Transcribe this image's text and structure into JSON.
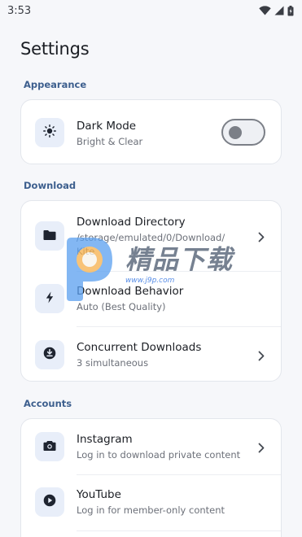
{
  "status_bar": {
    "time": "3:53",
    "icons": [
      "wifi-icon",
      "signal-icon",
      "battery-icon"
    ]
  },
  "page_title": "Settings",
  "sections": {
    "appearance": {
      "label": "Appearance",
      "dark_mode": {
        "title": "Dark Mode",
        "subtitle": "Bright & Clear",
        "icon": "sun-icon",
        "enabled": false
      }
    },
    "download": {
      "label": "Download",
      "directory": {
        "title": "Download Directory",
        "subtitle": "/storage/emulated/0/Download/",
        "subtitle2": "Kite",
        "icon": "folder-icon"
      },
      "behavior": {
        "title": "Download Behavior",
        "subtitle": "Auto (Best Quality)",
        "icon": "lightning-icon"
      },
      "concurrent": {
        "title": "Concurrent Downloads",
        "subtitle": "3 simultaneous",
        "icon": "download-circle-icon"
      }
    },
    "accounts": {
      "label": "Accounts",
      "instagram": {
        "title": "Instagram",
        "subtitle": "Log in to download private content",
        "icon": "camera-icon"
      },
      "youtube": {
        "title": "YouTube",
        "subtitle": "Log in for member-only content",
        "icon": "play-circle-icon"
      }
    }
  },
  "watermark": {
    "text": "精品下载",
    "url": "www.j9p.com"
  },
  "colors": {
    "background": "#f6f7fa",
    "card": "#ffffff",
    "section_label": "#3d5f8e",
    "icon_box": "#e8eef9",
    "icon": "#1e2430"
  }
}
